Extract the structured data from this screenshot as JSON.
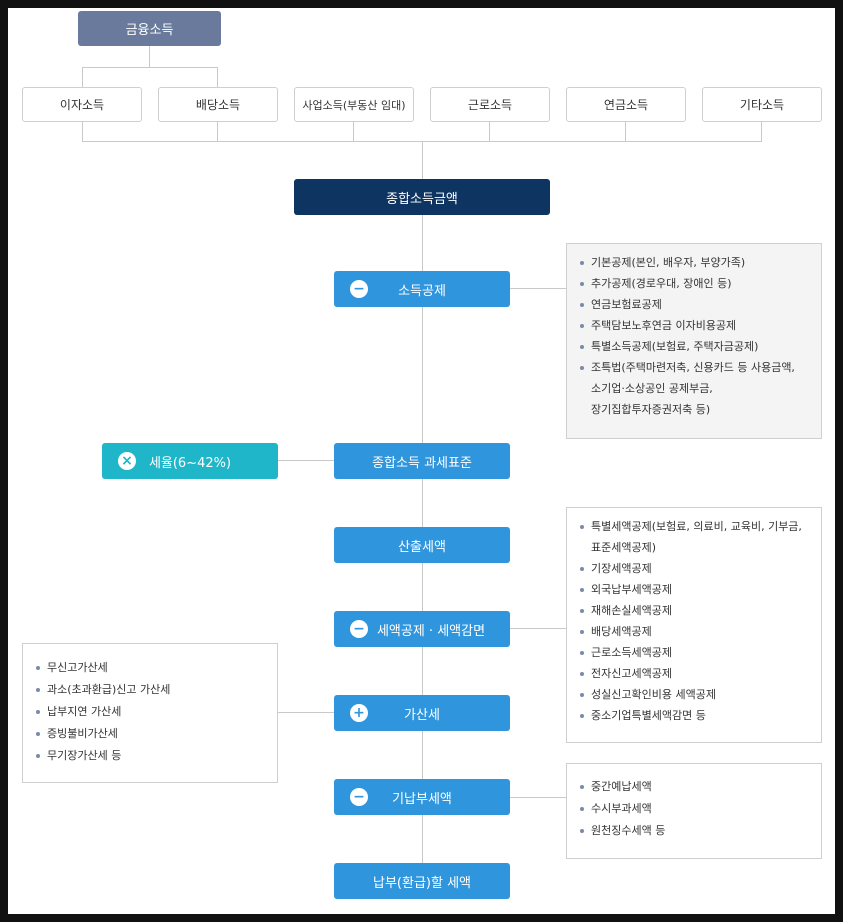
{
  "top_node": "금융소득",
  "categories": [
    "이자소득",
    "배당소득",
    "사업소득(부동산 임대)",
    "근로소득",
    "연금소득",
    "기타소득"
  ],
  "total_node": "종합소득금액",
  "steps": {
    "income_deduction": {
      "label": "소득공제",
      "symbol": "−"
    },
    "tax_base": {
      "label": "종합소득 과세표준"
    },
    "tax_rate": {
      "label": "세율(6~42%)",
      "symbol": "×"
    },
    "computed_tax": {
      "label": "산출세액"
    },
    "tax_credit": {
      "label": "세액공제 · 세액감면",
      "symbol": "−"
    },
    "penalty": {
      "label": "가산세",
      "symbol": "+"
    },
    "prepaid": {
      "label": "기납부세액",
      "symbol": "−"
    },
    "final": {
      "label": "납부(환급)할 세액"
    }
  },
  "income_deduction_items": [
    "기본공제(본인, 배우자, 부양가족)",
    "추가공제(경로우대, 장애인 등)",
    "연금보험료공제",
    "주택담보노후연금 이자비용공제",
    "특별소득공제(보험료, 주택자금공제)",
    "조특법(주택마련저축, 신용카드 등 사용금액,",
    "소기업·소상공인 공제부금,",
    "장기집합투자증권저축 등)"
  ],
  "tax_credit_items": [
    "특별세액공제(보험료, 의료비, 교육비, 기부금,",
    "표준세액공제)",
    "기장세액공제",
    "외국납부세액공제",
    "재해손실세액공제",
    "배당세액공제",
    "근로소득세액공제",
    "전자신고세액공제",
    "성실신고확인비용 세액공제",
    "중소기업특별세액감면 등"
  ],
  "penalty_items": [
    "무신고가산세",
    "과소(초과환급)신고 가산세",
    "납부지연 가산세",
    "증빙불비가산세",
    "무기장가산세 등"
  ],
  "prepaid_items": [
    "중간예납세액",
    "수시부과세액",
    "원천징수세액 등"
  ]
}
